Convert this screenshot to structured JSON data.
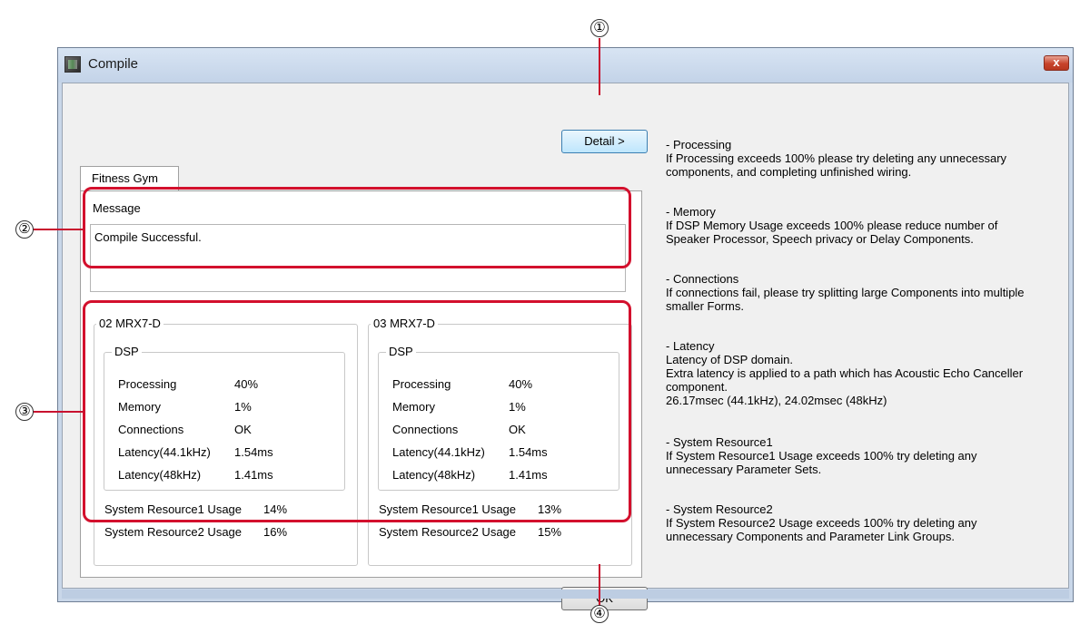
{
  "window": {
    "title": "Compile",
    "close_label": "x"
  },
  "buttons": {
    "detail": "Detail >",
    "ok": "OK"
  },
  "tab": {
    "label": "Fitness Gym"
  },
  "message": {
    "label": "Message",
    "text": "Compile Successful."
  },
  "devices": [
    {
      "name": "02 MRX7-D",
      "dsp_title": "DSP",
      "rows": [
        {
          "label": "Processing",
          "value": "40%"
        },
        {
          "label": "Memory",
          "value": "1%"
        },
        {
          "label": "Connections",
          "value": "OK"
        },
        {
          "label": "Latency(44.1kHz)",
          "value": "1.54ms"
        },
        {
          "label": "Latency(48kHz)",
          "value": "1.41ms"
        }
      ],
      "resources": [
        {
          "label": "System Resource1 Usage",
          "value": "14%"
        },
        {
          "label": "System Resource2 Usage",
          "value": "16%"
        }
      ]
    },
    {
      "name": "03 MRX7-D",
      "dsp_title": "DSP",
      "rows": [
        {
          "label": "Processing",
          "value": "40%"
        },
        {
          "label": "Memory",
          "value": "1%"
        },
        {
          "label": "Connections",
          "value": "OK"
        },
        {
          "label": "Latency(44.1kHz)",
          "value": "1.54ms"
        },
        {
          "label": "Latency(48kHz)",
          "value": "1.41ms"
        }
      ],
      "resources": [
        {
          "label": "System Resource1 Usage",
          "value": "13%"
        },
        {
          "label": "System Resource2 Usage",
          "value": "15%"
        }
      ]
    }
  ],
  "info": [
    {
      "title": "- Processing",
      "body": "If Processing exceeds 100% please try deleting any unnecessary\ncomponents, and completing unfinished wiring."
    },
    {
      "title": "- Memory",
      "body": "If DSP Memory Usage exceeds 100% please reduce number of\nSpeaker Processor, Speech privacy or Delay Components."
    },
    {
      "title": "- Connections",
      "body": "If connections fail, please try splitting large Components into multiple\nsmaller Forms."
    },
    {
      "title": "- Latency",
      "body": "Latency of DSP domain.\nExtra latency is applied to a path which has Acoustic Echo Canceller\ncomponent.\n26.17msec (44.1kHz), 24.02msec (48kHz)"
    },
    {
      "title": "- System Resource1",
      "body": "If System Resource1 Usage exceeds 100%  try deleting  any\nunnecessary Parameter Sets."
    },
    {
      "title": "- System Resource2",
      "body": "If System Resource2 Usage exceeds 100% try deleting  any\nunnecessary Components and Parameter Link Groups."
    }
  ],
  "callouts": [
    "①",
    "②",
    "③",
    "④"
  ],
  "colors": {
    "highlight": "#d3102d",
    "title_bar": "#c9d7e9"
  }
}
